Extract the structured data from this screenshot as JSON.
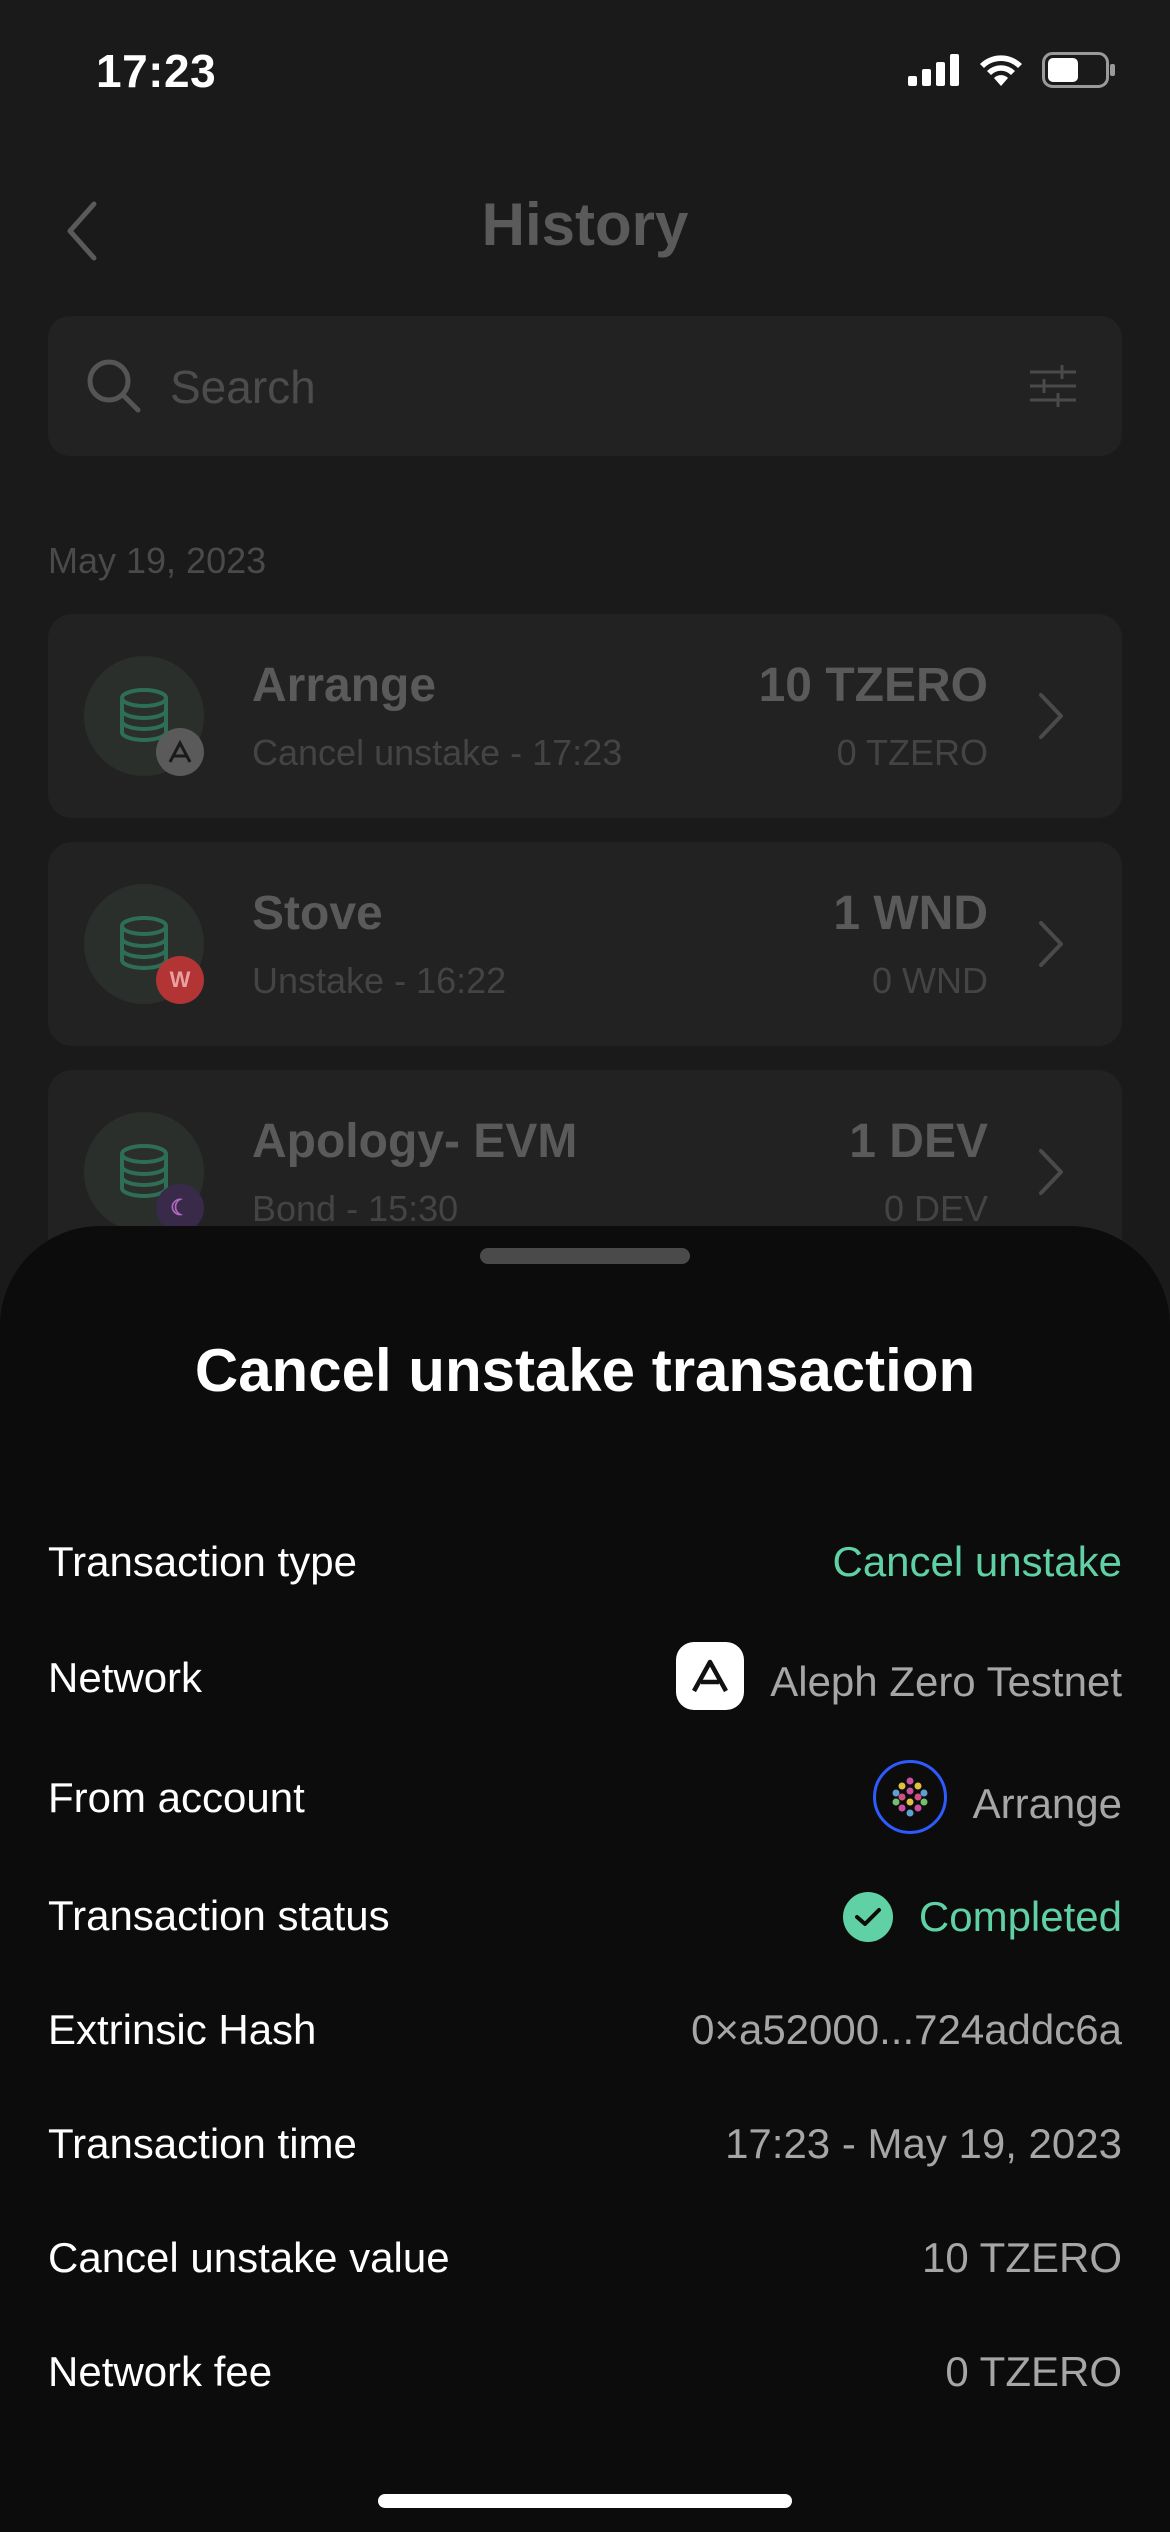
{
  "status_bar": {
    "time": "17:23"
  },
  "header": {
    "title": "History"
  },
  "search": {
    "placeholder": "Search"
  },
  "history": {
    "date": "May 19, 2023",
    "items": [
      {
        "name": "Arrange",
        "subtitle": "Cancel unstake - 17:23",
        "amount": "10 TZERO",
        "fee": "0 TZERO",
        "badge_icon": "aleph-zero-icon",
        "badge_color": "#5a5a5a"
      },
      {
        "name": "Stove",
        "subtitle": "Unstake - 16:22",
        "amount": "1 WND",
        "fee": "0 WND",
        "badge_icon": "westend-icon",
        "badge_color": "#b33434"
      },
      {
        "name": "Apology- EVM",
        "subtitle": "Bond - 15:30",
        "amount": "1 DEV",
        "fee": "0 DEV",
        "badge_icon": "moonbase-icon",
        "badge_color": "#6b3aa0"
      }
    ]
  },
  "sheet": {
    "title": "Cancel unstake transaction",
    "rows": [
      {
        "label": "Transaction type",
        "value": "Cancel unstake"
      },
      {
        "label": "Network",
        "value": "Aleph Zero Testnet"
      },
      {
        "label": "From account",
        "value": "Arrange"
      },
      {
        "label": "Transaction status",
        "value": "Completed"
      },
      {
        "label": "Extrinsic Hash",
        "value": "0×a52000...724addc6a"
      },
      {
        "label": "Transaction time",
        "value": "17:23 - May 19, 2023"
      },
      {
        "label": "Cancel unstake value",
        "value": "10 TZERO"
      },
      {
        "label": "Network fee",
        "value": "0 TZERO"
      }
    ]
  },
  "colors": {
    "accent": "#5fd1a5",
    "sheet_background": "#0c0c0c",
    "overlay_background": "#1a1a1a"
  }
}
